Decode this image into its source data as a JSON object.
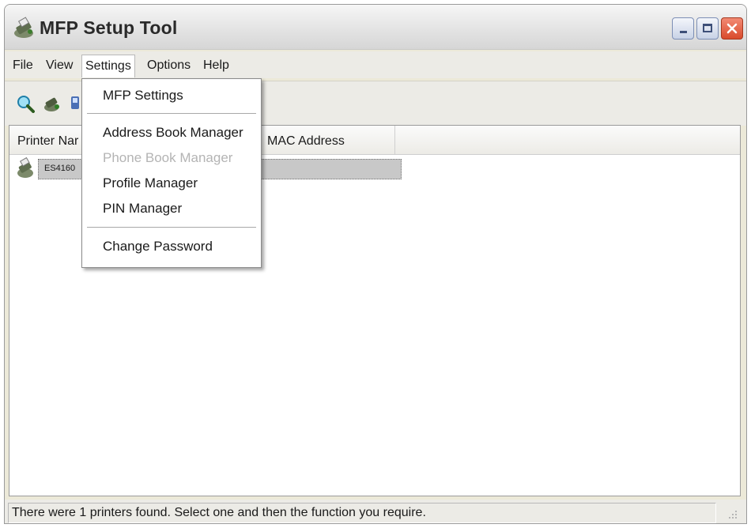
{
  "window": {
    "title": "MFP Setup Tool",
    "icon": "printer-icon"
  },
  "menubar": {
    "items": [
      "File",
      "View",
      "Settings",
      "Options",
      "Help"
    ],
    "active": "Settings"
  },
  "toolbar": {
    "icons": [
      "search-icon",
      "printer-icon",
      "network-icon"
    ]
  },
  "listview": {
    "columns": [
      "Printer Nar",
      "MAC Address"
    ],
    "rows": [
      {
        "name": "ES4160",
        "icon": "printer-icon",
        "selected": true
      }
    ]
  },
  "settings_menu": {
    "items": [
      {
        "label": "MFP Settings",
        "enabled": true
      },
      {
        "label": "Address Book Manager",
        "enabled": true
      },
      {
        "label": "Phone Book Manager",
        "enabled": false
      },
      {
        "label": "Profile Manager",
        "enabled": true
      },
      {
        "label": "PIN Manager",
        "enabled": true
      },
      {
        "label": "Change Password",
        "enabled": true
      }
    ]
  },
  "statusbar": {
    "text": "There were 1 printers found. Select one and then the function you require."
  },
  "colors": {
    "close_button": "#d94a2b",
    "selection": "#c8c8c8",
    "disabled_text": "#b4b4b4"
  }
}
